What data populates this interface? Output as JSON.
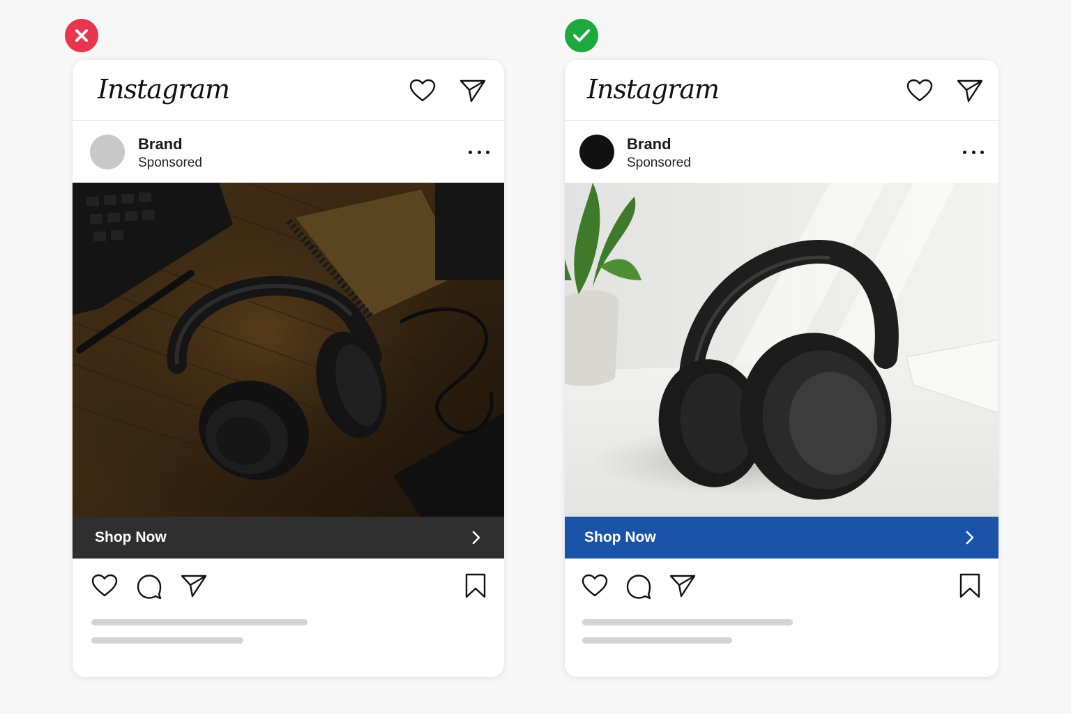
{
  "examples": [
    {
      "verdict": "incorrect",
      "verdict_icon": "x-mark-icon",
      "verdict_color": "#e8364f",
      "header": {
        "logo_text": "Instagram"
      },
      "post": {
        "brand_name": "Brand",
        "sponsored_label": "Sponsored",
        "avatar_color": "#c8c8c8",
        "image": "headphones on a dark wooden desk with keyboard, notebook, mug and cables"
      },
      "cta": {
        "label": "Shop Now",
        "background": "#2f2f2f"
      }
    },
    {
      "verdict": "correct",
      "verdict_icon": "check-mark-icon",
      "verdict_color": "#1fa83f",
      "header": {
        "logo_text": "Instagram"
      },
      "post": {
        "brand_name": "Brand",
        "sponsored_label": "Sponsored",
        "avatar_color": "#111111",
        "image": "black over-ear headphones on a bright white desk with a potted plant and a book"
      },
      "cta": {
        "label": "Shop Now",
        "background": "#1a53a8"
      }
    }
  ]
}
